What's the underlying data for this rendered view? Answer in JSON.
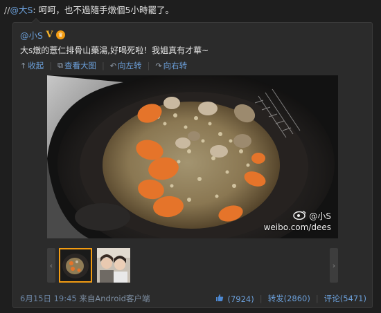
{
  "repost": {
    "prefix": "//",
    "mention": "@大S",
    "text": ": 呵呵，也不過隨手燉個5小時罷了。"
  },
  "original": {
    "author": "@小S",
    "verified_badge": "V",
    "post_text": "大s燉的薏仁排骨山藥湯,好喝死啦！我姐真有才華~",
    "actions": {
      "collapse": "收起",
      "view_large": "查看大图",
      "rotate_left": "向左转",
      "rotate_right": "向右转"
    },
    "image": {
      "watermark_user": "@小S",
      "watermark_url": "weibo.com/dees"
    },
    "thumbnails": {
      "count": 2,
      "selected_index": 0
    },
    "footer": {
      "timestamp": "6月15日 19:45",
      "source": "来自Android客户端",
      "likes": "(7924)",
      "repost_label": "转发(2860)",
      "comment_label": "评论(5471)"
    }
  },
  "colors": {
    "link": "#6b9fd9",
    "background": "#1e1e1e",
    "card": "#2b2b2b",
    "thumb_selected": "#f39c12"
  },
  "icons": [
    "collapse-icon",
    "view-large-icon",
    "rotate-left-icon",
    "rotate-right-icon",
    "thumbs-up-icon",
    "weibo-eye-icon",
    "chevron-left-icon",
    "chevron-right-icon"
  ]
}
